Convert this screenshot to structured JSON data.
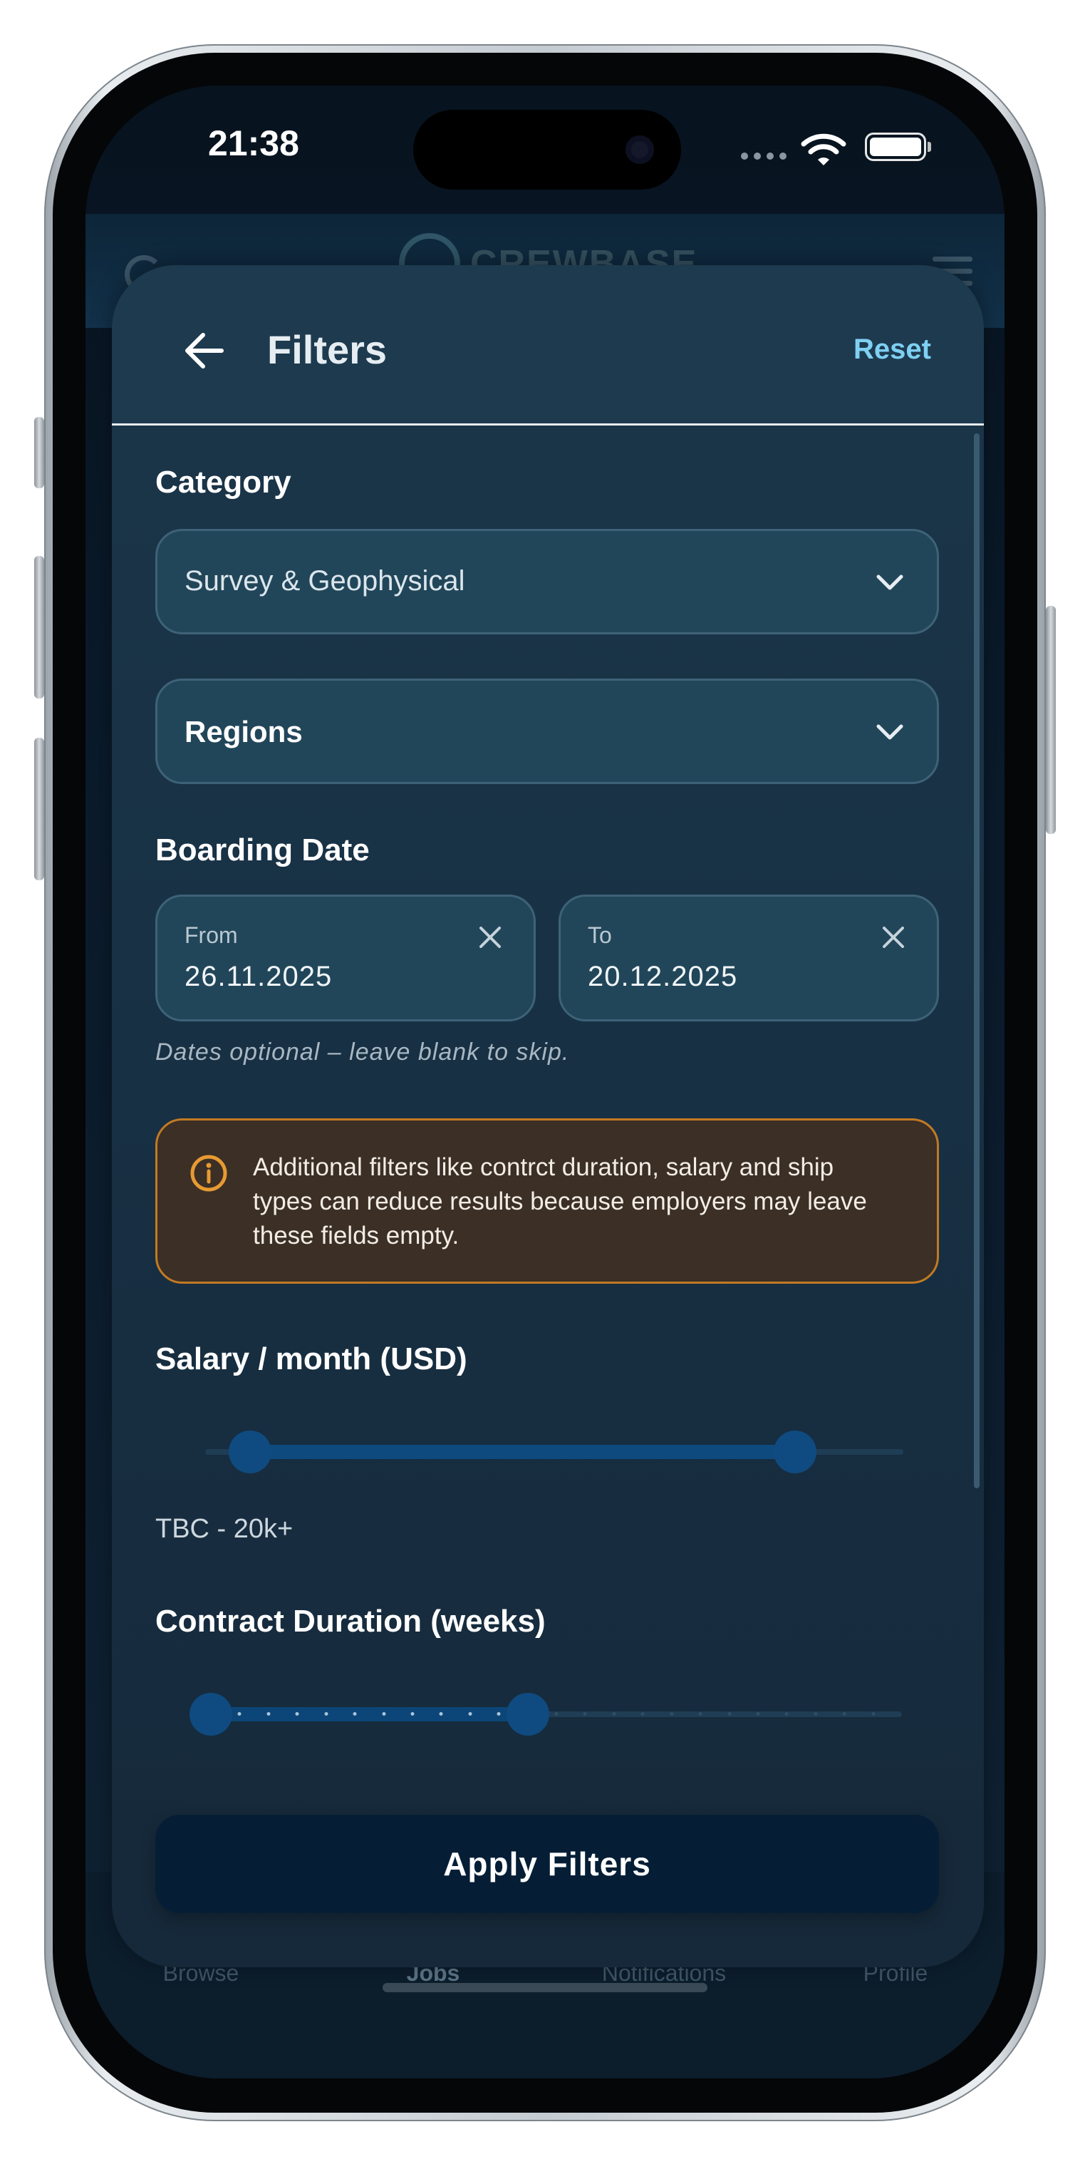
{
  "status_bar": {
    "time": "21:38"
  },
  "background_app": {
    "logo_text": "CREWBASE",
    "tabs": [
      {
        "label": "Browse",
        "active": false
      },
      {
        "label": "Jobs",
        "active": true
      },
      {
        "label": "Notifications",
        "active": false
      },
      {
        "label": "Profile",
        "active": false
      }
    ]
  },
  "filters": {
    "title": "Filters",
    "reset_label": "Reset",
    "category": {
      "label": "Category",
      "selected": "Survey & Geophysical",
      "icon": "chevron-down-icon"
    },
    "regions": {
      "placeholder": "Regions",
      "icon": "chevron-down-icon"
    },
    "boarding_date": {
      "label": "Boarding Date",
      "from_label": "From",
      "from_value": "26.11.2025",
      "to_label": "To",
      "to_value": "20.12.2025",
      "hint": "Dates optional – leave blank to skip."
    },
    "notice": {
      "icon": "info-icon",
      "text": "Additional filters like contrct duration, salary and ship types can reduce results because employers may leave these fields empty.",
      "color": "#c27a23"
    },
    "salary": {
      "label": "Salary / month (USD)",
      "range_text": "TBC - 20k+",
      "min_fraction": 0.0,
      "max_fraction": 0.85
    },
    "contract_duration": {
      "label": "Contract Duration (weeks)",
      "steps": 24,
      "min_step": 0,
      "max_step": 11
    },
    "apply_label": "Apply Filters"
  },
  "colors": {
    "accent": "#7fd0f2",
    "slider_active": "#0f4b80",
    "apply_button": "#051e36"
  }
}
